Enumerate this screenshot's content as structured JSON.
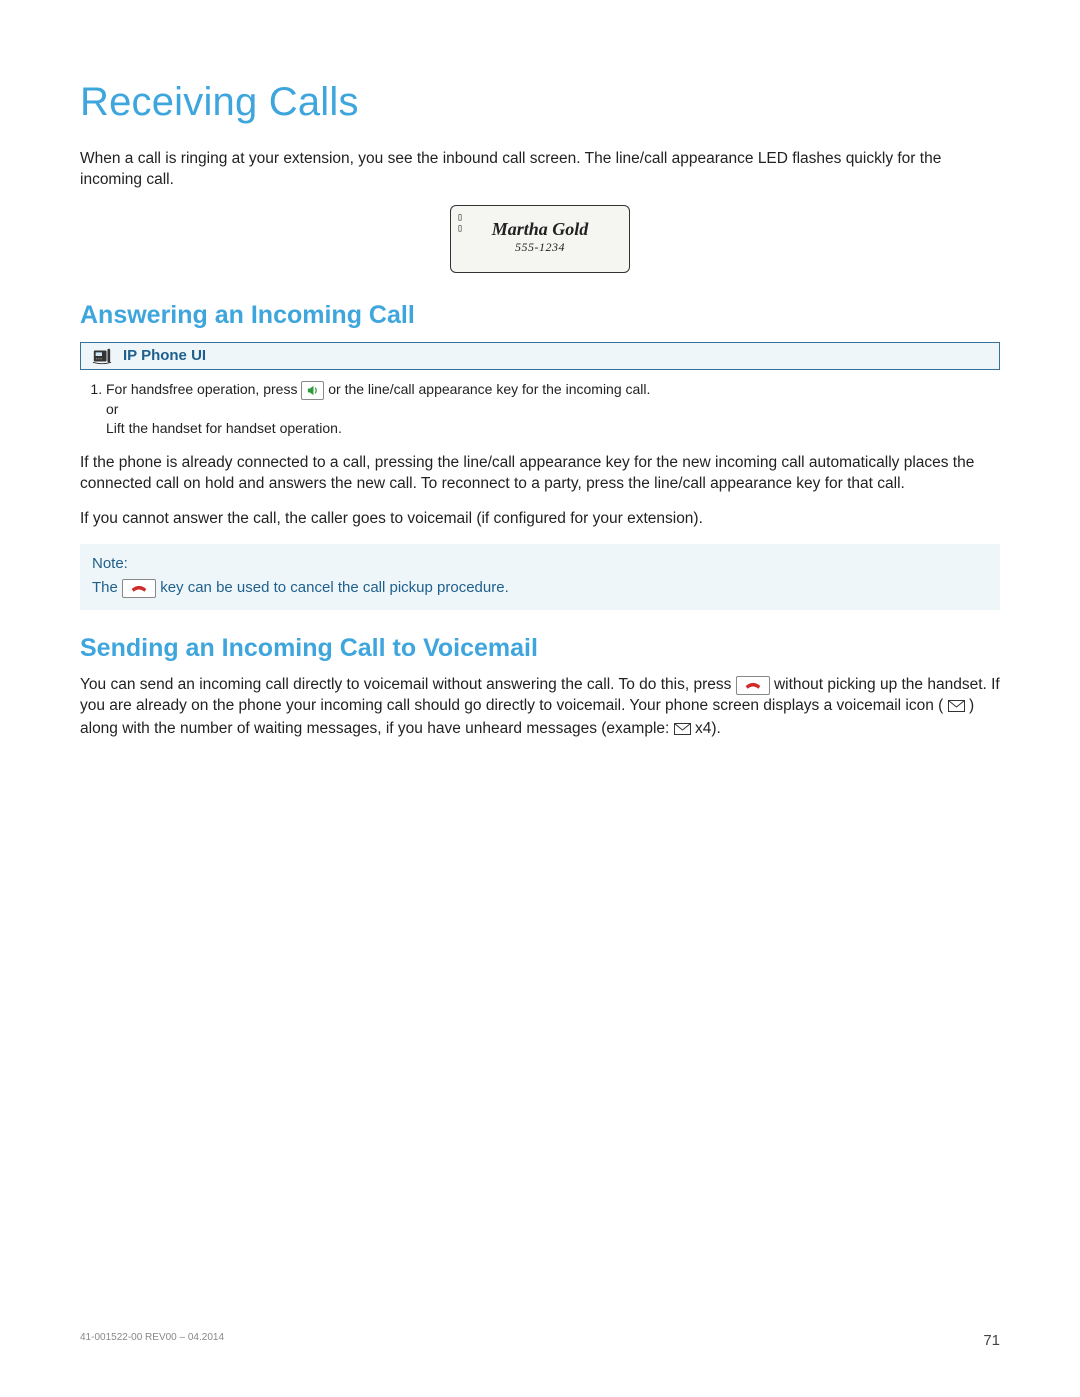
{
  "title": "Receiving Calls",
  "intro": "When a call is ringing at your extension, you see the inbound call screen. The line/call appearance LED flashes quickly for the incoming call.",
  "lcd": {
    "caller_name": "Martha Gold",
    "caller_number": "555-1234"
  },
  "section_answer": {
    "heading": "Answering an Incoming Call",
    "banner": "IP Phone UI",
    "step1_a": "For handsfree operation, press",
    "step1_b": "or the line/call appearance key for the incoming call.",
    "step1_or": "or",
    "step1_c": "Lift the handset for handset operation.",
    "para1": "If the phone is already connected to a call, pressing the line/call appearance key for the new incoming call automatically places the connected call on hold and answers the new call. To reconnect to a party, press the line/call appearance key for that call.",
    "para2": "If you cannot answer the call, the caller goes to voicemail (if configured for your extension).",
    "note_label": "Note:",
    "note_a": "The",
    "note_b": "key can be used to cancel the call pickup procedure."
  },
  "section_vm": {
    "heading": "Sending an Incoming Call to Voicemail",
    "text_a": "You can send an incoming call directly to voicemail without answering the call. To do this, press",
    "text_b": "without picking up the handset. If you are already on the phone your incoming call should go directly to voicemail. Your phone screen displays a voicemail icon (",
    "text_c": ") along with the number of waiting messages, if you have unheard messages (example:",
    "text_d": " x4)."
  },
  "footer": {
    "doc": "41-001522-00 REV00 – 04.2014",
    "page": "71"
  }
}
